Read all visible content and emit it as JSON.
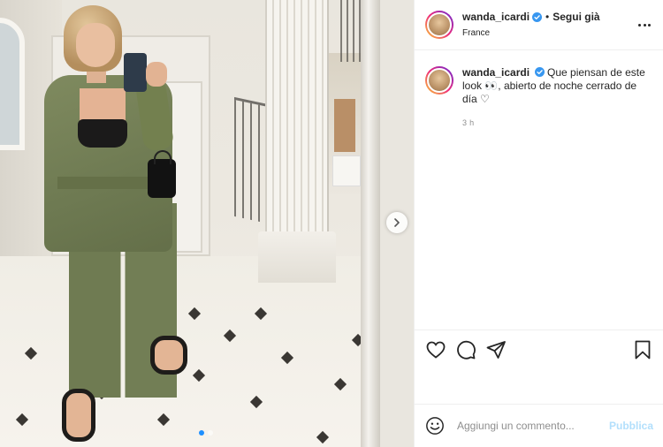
{
  "post": {
    "author": "wanda_icardi",
    "verified": true,
    "follow_label": "Segui già",
    "separator": "•",
    "location": "France",
    "caption_username": "wanda_icardi",
    "caption_text": "Que piensan de este look 👀, abierto de noche cerrado de día ♡",
    "time": "3 h",
    "carousel": {
      "current": 1,
      "total": 2
    }
  },
  "comment": {
    "placeholder": "Aggiungi un commento...",
    "publish_label": "Pubblica"
  },
  "icons": {
    "more": "more-horizontal-icon",
    "like": "heart-icon",
    "comment": "comment-icon",
    "share": "share-plane-icon",
    "save": "bookmark-icon",
    "emoji": "emoji-smile-icon",
    "next": "chevron-right-icon",
    "verified": "verified-badge-icon"
  },
  "colors": {
    "text": "#262626",
    "muted": "#8e8e8e",
    "verified_blue": "#3897f0",
    "publish_disabled": "#b2dffc",
    "carousel_active": "#1e90ff"
  }
}
